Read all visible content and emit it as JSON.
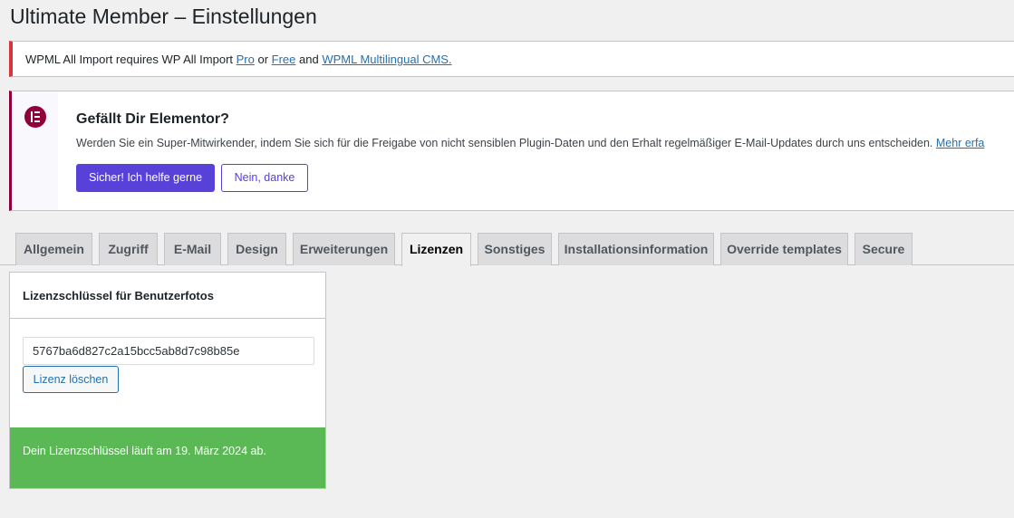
{
  "page": {
    "title": "Ultimate Member – Einstellungen"
  },
  "wpml_notice": {
    "text_1": "WPML All Import requires WP All Import ",
    "link_pro": "Pro",
    "text_2": " or ",
    "link_free": "Free",
    "text_3": " and ",
    "link_wpml": "WPML Multilingual CMS.",
    "accent_color": "#d63638"
  },
  "elementor_notice": {
    "icon": "elementor-logo-icon",
    "title": "Gefällt Dir Elementor?",
    "text": "Werden Sie ein Super-Mitwirkender, indem Sie sich für die Freigabe von nicht sensiblen Plugin-Daten und den Erhalt regelmäßiger E-Mail-Updates durch uns entscheiden. ",
    "more_link": "Mehr erfa",
    "accept_label": "Sicher! Ich helfe gerne",
    "decline_label": "Nein, danke",
    "brand_color": "#92003b",
    "button_color": "#5741d9"
  },
  "tabs": [
    {
      "label": "Allgemein",
      "active": false
    },
    {
      "label": "Zugriff",
      "active": false
    },
    {
      "label": "E-Mail",
      "active": false
    },
    {
      "label": "Design",
      "active": false
    },
    {
      "label": "Erweiterungen",
      "active": false
    },
    {
      "label": "Lizenzen",
      "active": true
    },
    {
      "label": "Sonstiges",
      "active": false
    },
    {
      "label": "Installationsinformation",
      "active": false
    },
    {
      "label": "Override templates",
      "active": false
    },
    {
      "label": "Secure",
      "active": false
    }
  ],
  "license_panel": {
    "heading": "Lizenzschlüssel für Benutzerfotos",
    "key_value": "5767ba6d827c2a15bcc5ab8d7c98b85e",
    "clear_button": "Lizenz löschen",
    "status_text": "Dein Lizenzschlüssel läuft am 19. März 2024 ab.",
    "status_color": "#5ab955"
  }
}
